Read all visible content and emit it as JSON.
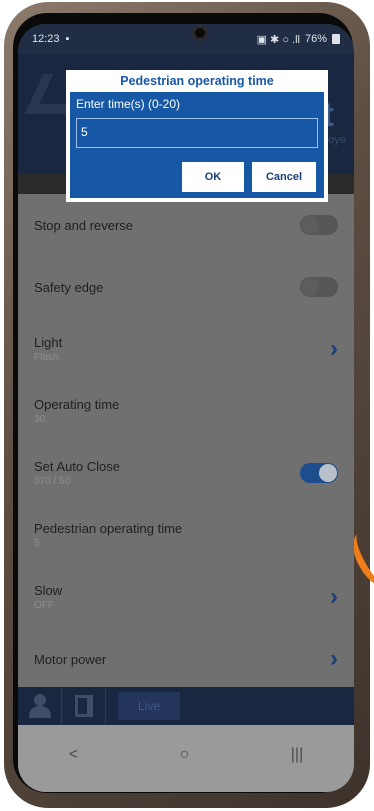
{
  "status": {
    "time": "12:23",
    "icons": "▣ ✱ ○ .ll",
    "battery": "76%"
  },
  "header_ghost": {
    "t_text": "t",
    "sub_text": "oye"
  },
  "dialog": {
    "title": "Pedestrian operating time",
    "label": "Enter time(s) (0-20)",
    "value": "5",
    "ok_label": "OK",
    "cancel_label": "Cancel"
  },
  "settings": [
    {
      "title": "Stop and reverse",
      "sub": "",
      "control": "toggle",
      "on": false
    },
    {
      "title": "Safety edge",
      "sub": "",
      "control": "toggle",
      "on": false
    },
    {
      "title": "Light",
      "sub": "Flash",
      "control": "chevron"
    },
    {
      "title": "Operating time",
      "sub": "30",
      "control": "none"
    },
    {
      "title": "Set Auto Close",
      "sub": "070 / 50",
      "control": "toggle",
      "on": true
    },
    {
      "title": "Pedestrian operating time",
      "sub": "5",
      "control": "none"
    },
    {
      "title": "Slow",
      "sub": "OFF",
      "control": "chevron"
    },
    {
      "title": "Motor power",
      "sub": "",
      "control": "chevron"
    }
  ],
  "bottom_bar": {
    "live_label": "Live"
  },
  "navbar": {
    "back": "<",
    "home": "○",
    "recents": "|||"
  },
  "colors": {
    "accent": "#1758a6",
    "orange": "#ef7d1a"
  }
}
